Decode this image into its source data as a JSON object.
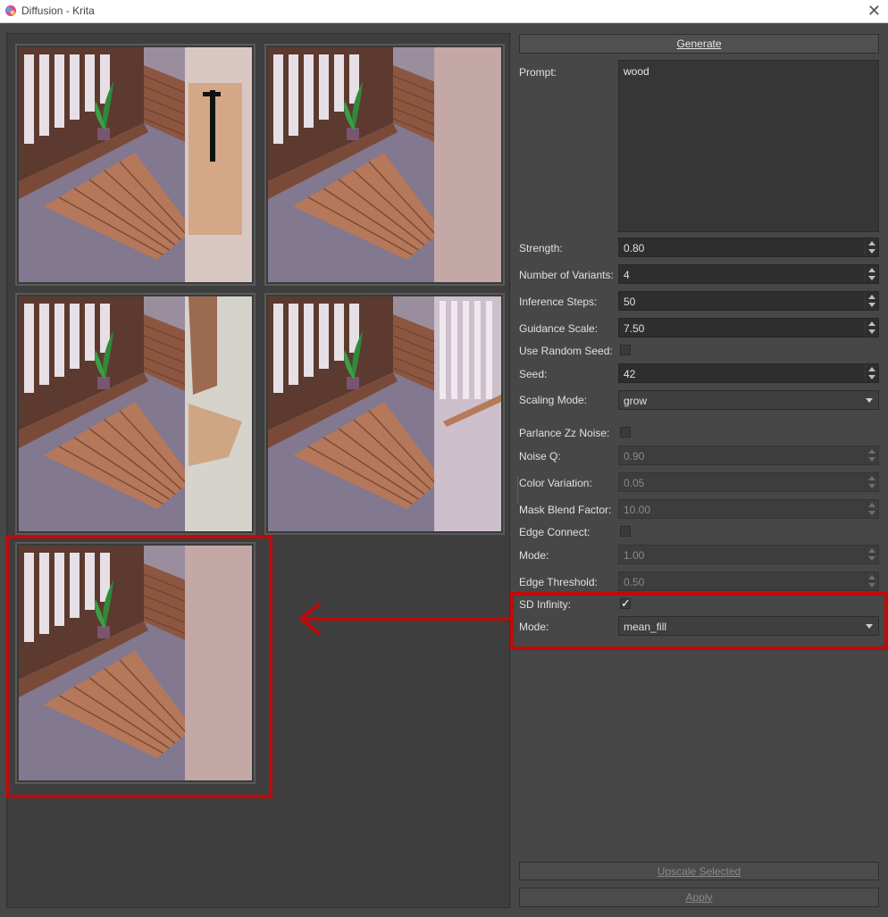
{
  "window": {
    "title": "Diffusion - Krita",
    "app_icon": "krita-logo-icon",
    "close_icon": "close-icon"
  },
  "previews": [
    {
      "label": "variant-1",
      "right_panel": "wood-column"
    },
    {
      "label": "variant-2",
      "right_panel": "pink-fill"
    },
    {
      "label": "variant-3",
      "right_panel": "wood-drape"
    },
    {
      "label": "variant-4",
      "right_panel": "wood-branch"
    },
    {
      "label": "variant-5",
      "right_panel": "pink-fill"
    }
  ],
  "settings": {
    "generate_label": "Generate",
    "prompt_label": "Prompt:",
    "prompt_value": "wood",
    "strength_label": "Strength:",
    "strength_value": "0.80",
    "variants_label": "Number of Variants:",
    "variants_value": "4",
    "steps_label": "Inference Steps:",
    "steps_value": "50",
    "guidance_label": "Guidance Scale:",
    "guidance_value": "7.50",
    "random_seed_label": "Use Random Seed:",
    "random_seed_checked": false,
    "seed_label": "Seed:",
    "seed_value": "42",
    "scaling_label": "Scaling Mode:",
    "scaling_value": "grow",
    "parlance_label": "Parlance Zz Noise:",
    "parlance_checked": false,
    "noise_q_label": "Noise Q:",
    "noise_q_value": "0.90",
    "color_var_label": "Color Variation:",
    "color_var_value": "0.05",
    "mask_blend_label": "Mask Blend Factor:",
    "mask_blend_value": "10.00",
    "edge_connect_label": "Edge Connect:",
    "edge_connect_checked": false,
    "mode1_label": "Mode:",
    "mode1_value": "1.00",
    "edge_threshold_label": "Edge Threshold:",
    "edge_threshold_value": "0.50",
    "sd_infinity_label": "SD Infinity:",
    "sd_infinity_checked": true,
    "sd_infinity_tick": "✓",
    "mode2_label": "Mode:",
    "mode2_value": "mean_fill",
    "upscale_label": "Upscale Selected",
    "apply_label": "Apply"
  },
  "colors": {
    "annotation_red": "#c00a0a",
    "panel_bg": "#474747"
  }
}
